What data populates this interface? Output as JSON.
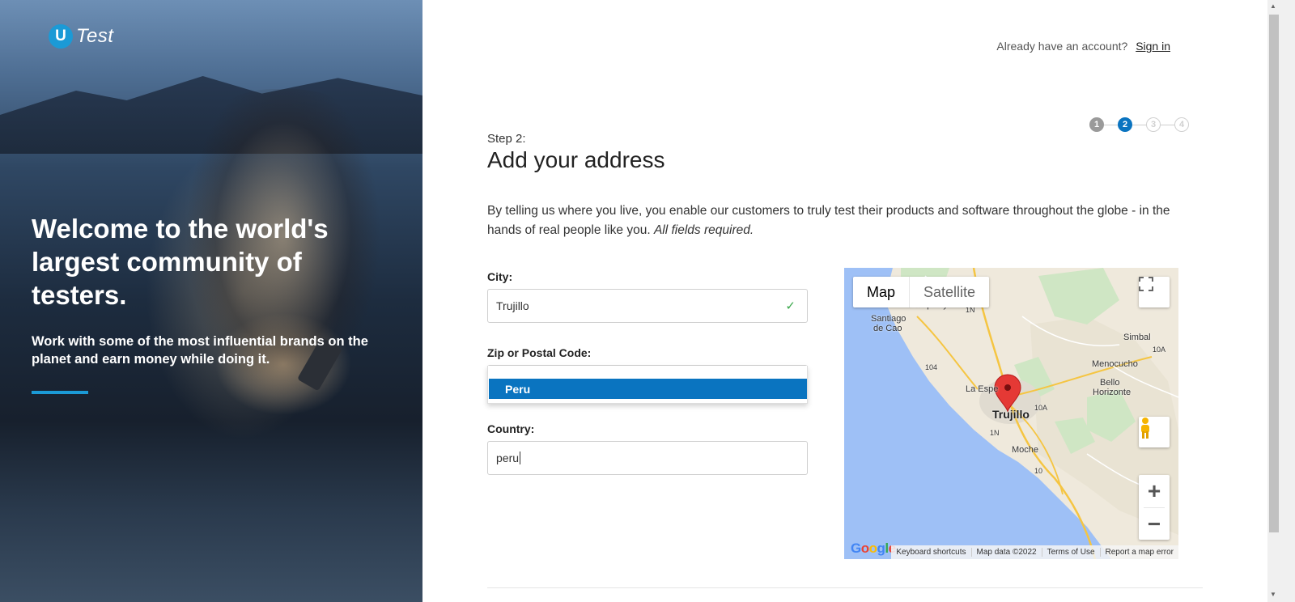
{
  "brand": {
    "logo_letter": "U",
    "logo_text": "Test",
    "accent": "#1b9ad6"
  },
  "hero": {
    "headline": "Welcome to the world's largest community of testers.",
    "subtext": "Work with some of the most influential brands on the planet and earn money while doing it."
  },
  "header": {
    "signin_prompt": "Already have an account?",
    "signin_link": "Sign in"
  },
  "stepper": {
    "steps": [
      "1",
      "2",
      "3",
      "4"
    ],
    "active": 2,
    "active_color": "#0a74c0"
  },
  "form": {
    "step_label": "Step 2:",
    "title": "Add your address",
    "intro": "By telling us where you live, you enable our customers to truly test their products and software throughout the globe - in the hands of real people like you.",
    "intro_emphasis": "All fields required.",
    "city_label": "City:",
    "city_value": "Trujillo",
    "zip_label": "Zip or Postal Code:",
    "zip_value": "",
    "country_label": "Country:",
    "country_value": "peru",
    "suggestions": [
      "Peru"
    ]
  },
  "map": {
    "type_map": "Map",
    "type_satellite": "Satellite",
    "labels": {
      "chiquitoy": "Chiquitoy",
      "santiago_1": "Santiago",
      "santiago_2": "de Cao",
      "simbal": "Simbal",
      "menocucho": "Menocucho",
      "bello_1": "Bello",
      "bello_2": "Horizonte",
      "la_esperanza": "La Espe",
      "trujillo": "Trujillo",
      "moche": "Moche",
      "r1n_top": "1N",
      "r104": "104",
      "r10a_a": "10A",
      "r10a_b": "10A",
      "r1n_bottom": "1N",
      "r10": "10"
    },
    "footer": [
      "Keyboard shortcuts",
      "Map data ©2022",
      "Terms of Use",
      "Report a map error"
    ],
    "google": "Google"
  }
}
